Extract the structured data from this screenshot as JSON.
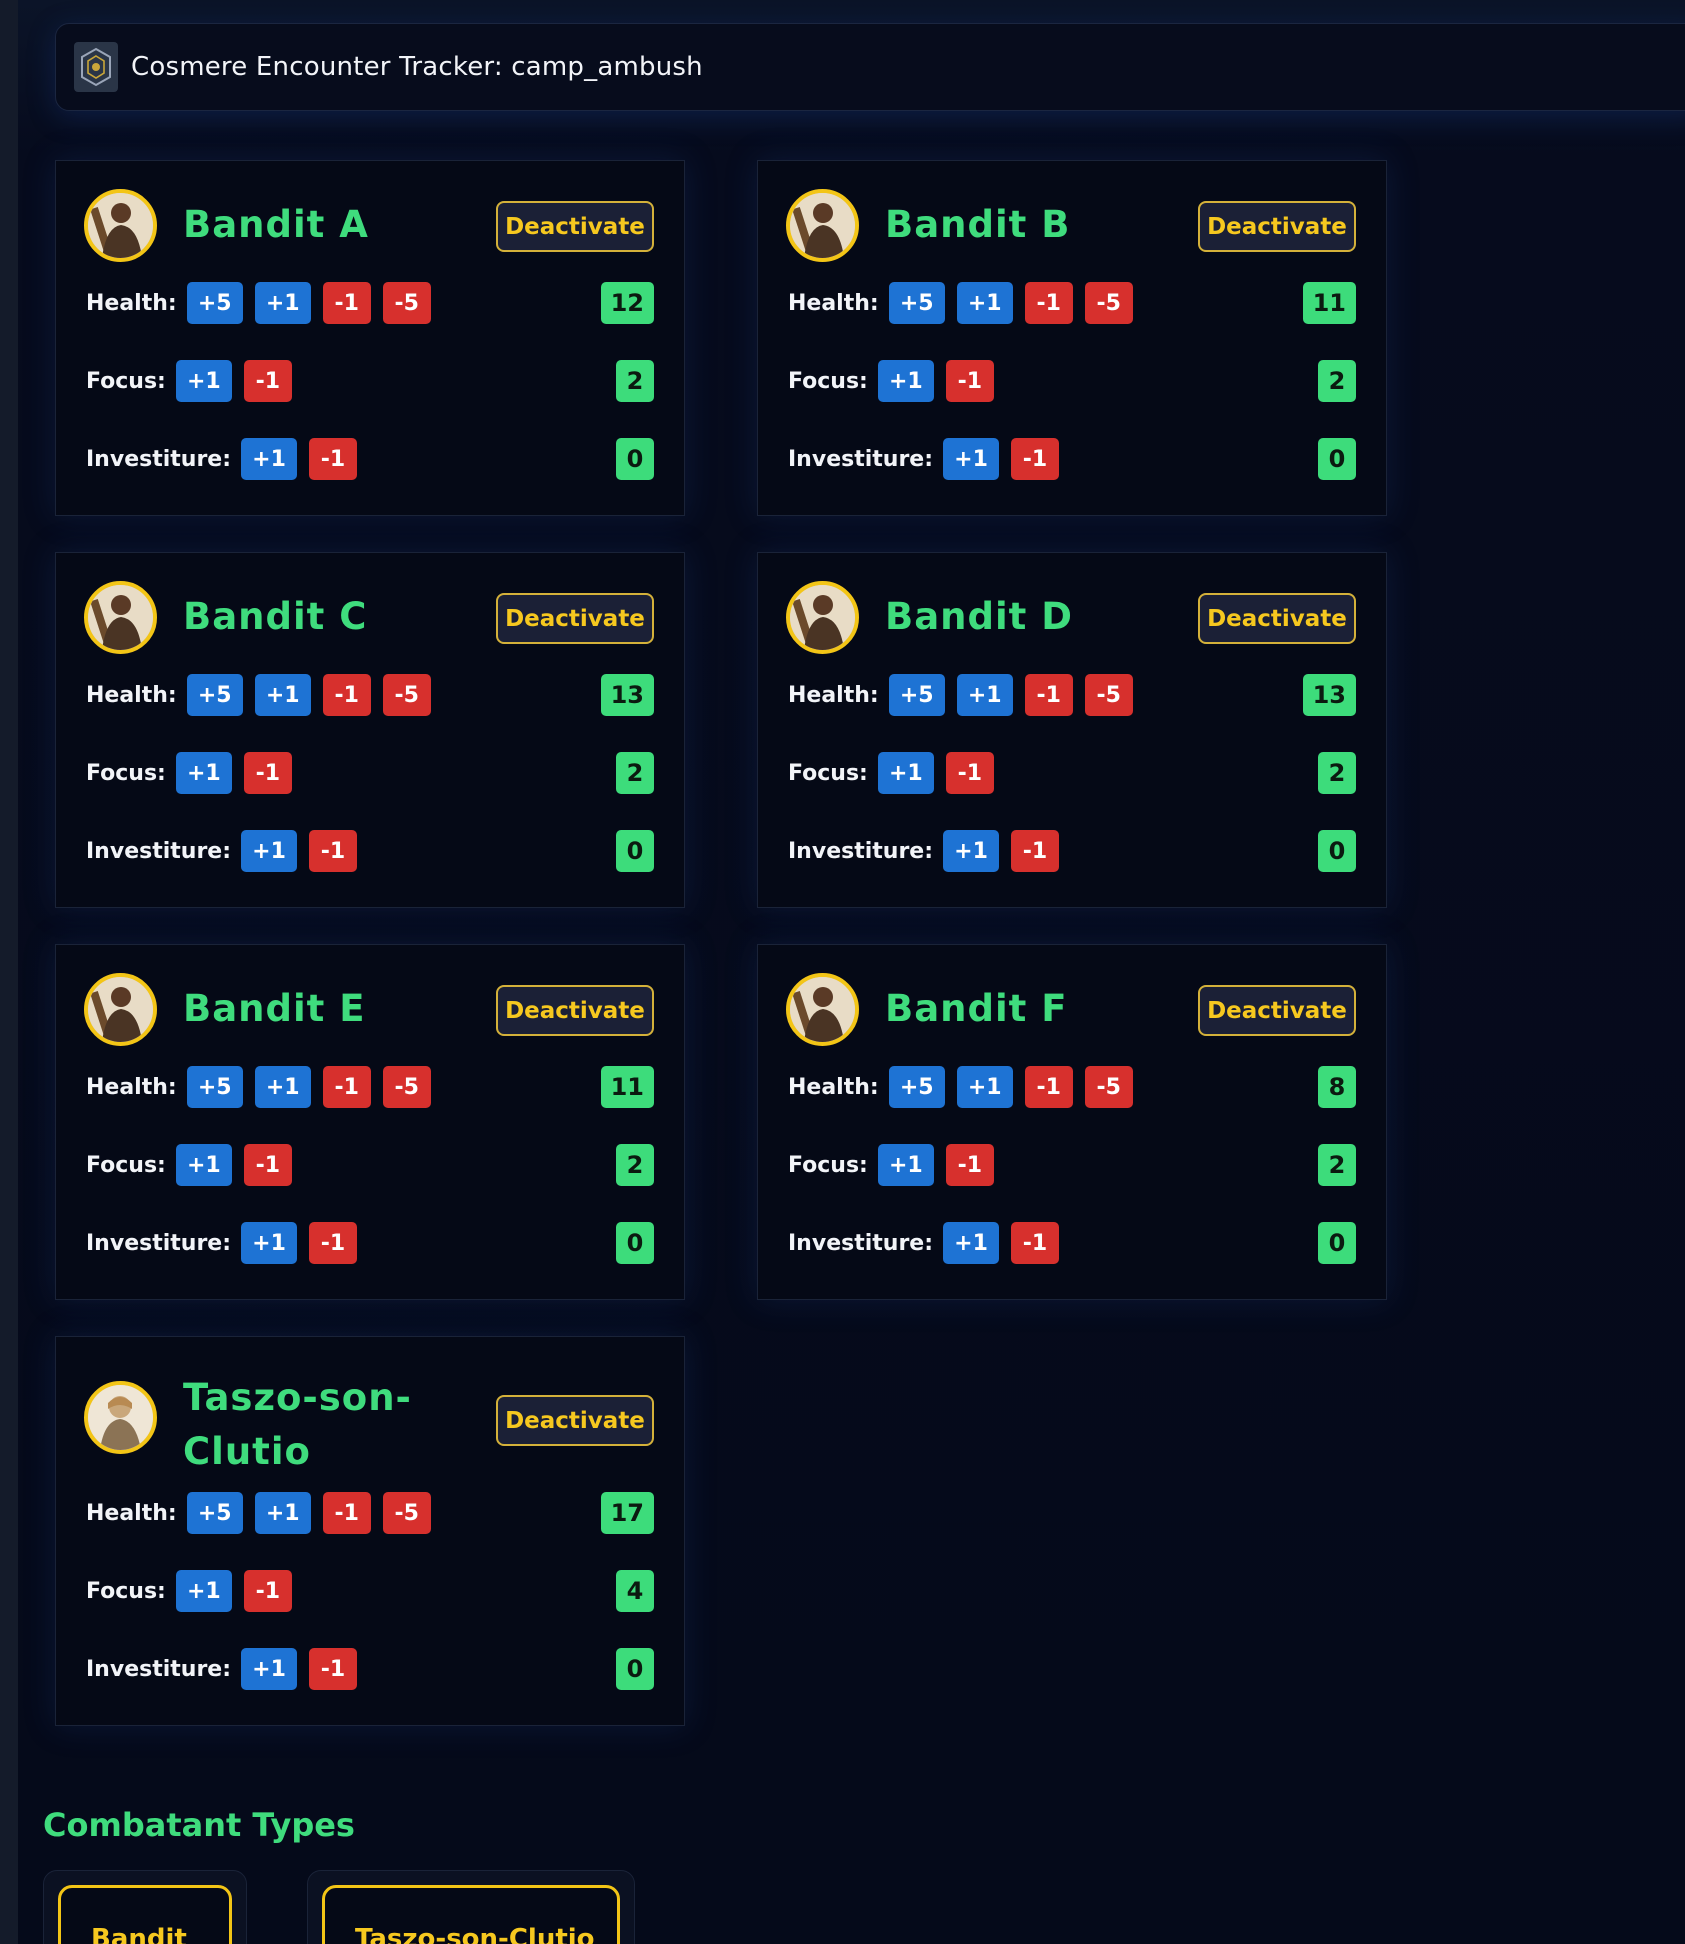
{
  "header": {
    "title": "Cosmere Encounter Tracker: camp_ambush",
    "logo_icon": "shield-emblem-icon"
  },
  "labels": {
    "health": "Health:",
    "focus": "Focus:",
    "investiture": "Investiture:"
  },
  "buttons": {
    "plus5": "+5",
    "plus1": "+1",
    "minus1": "-1",
    "minus5": "-5",
    "deactivate": "Deactivate"
  },
  "combatants": [
    {
      "name": "Bandit A",
      "health": "12",
      "focus": "2",
      "investiture": "0"
    },
    {
      "name": "Bandit B",
      "health": "11",
      "focus": "2",
      "investiture": "0"
    },
    {
      "name": "Bandit C",
      "health": "13",
      "focus": "2",
      "investiture": "0"
    },
    {
      "name": "Bandit D",
      "health": "13",
      "focus": "2",
      "investiture": "0"
    },
    {
      "name": "Bandit E",
      "health": "11",
      "focus": "2",
      "investiture": "0"
    },
    {
      "name": "Bandit F",
      "health": "8",
      "focus": "2",
      "investiture": "0"
    },
    {
      "name": "Taszo-son-Clutio",
      "health": "17",
      "focus": "4",
      "investiture": "0"
    }
  ],
  "combatant_types": {
    "title": "Combatant Types",
    "items": [
      {
        "label": "Bandit"
      },
      {
        "label": "Taszo-son-Clutio"
      }
    ]
  },
  "colors": {
    "name_green": "#3fdc7d",
    "value_green": "#3ddc7b",
    "plus_blue": "#1e73d4",
    "minus_red": "#d7302d",
    "accent_gold": "#f3c516",
    "background": "#050a1a"
  }
}
